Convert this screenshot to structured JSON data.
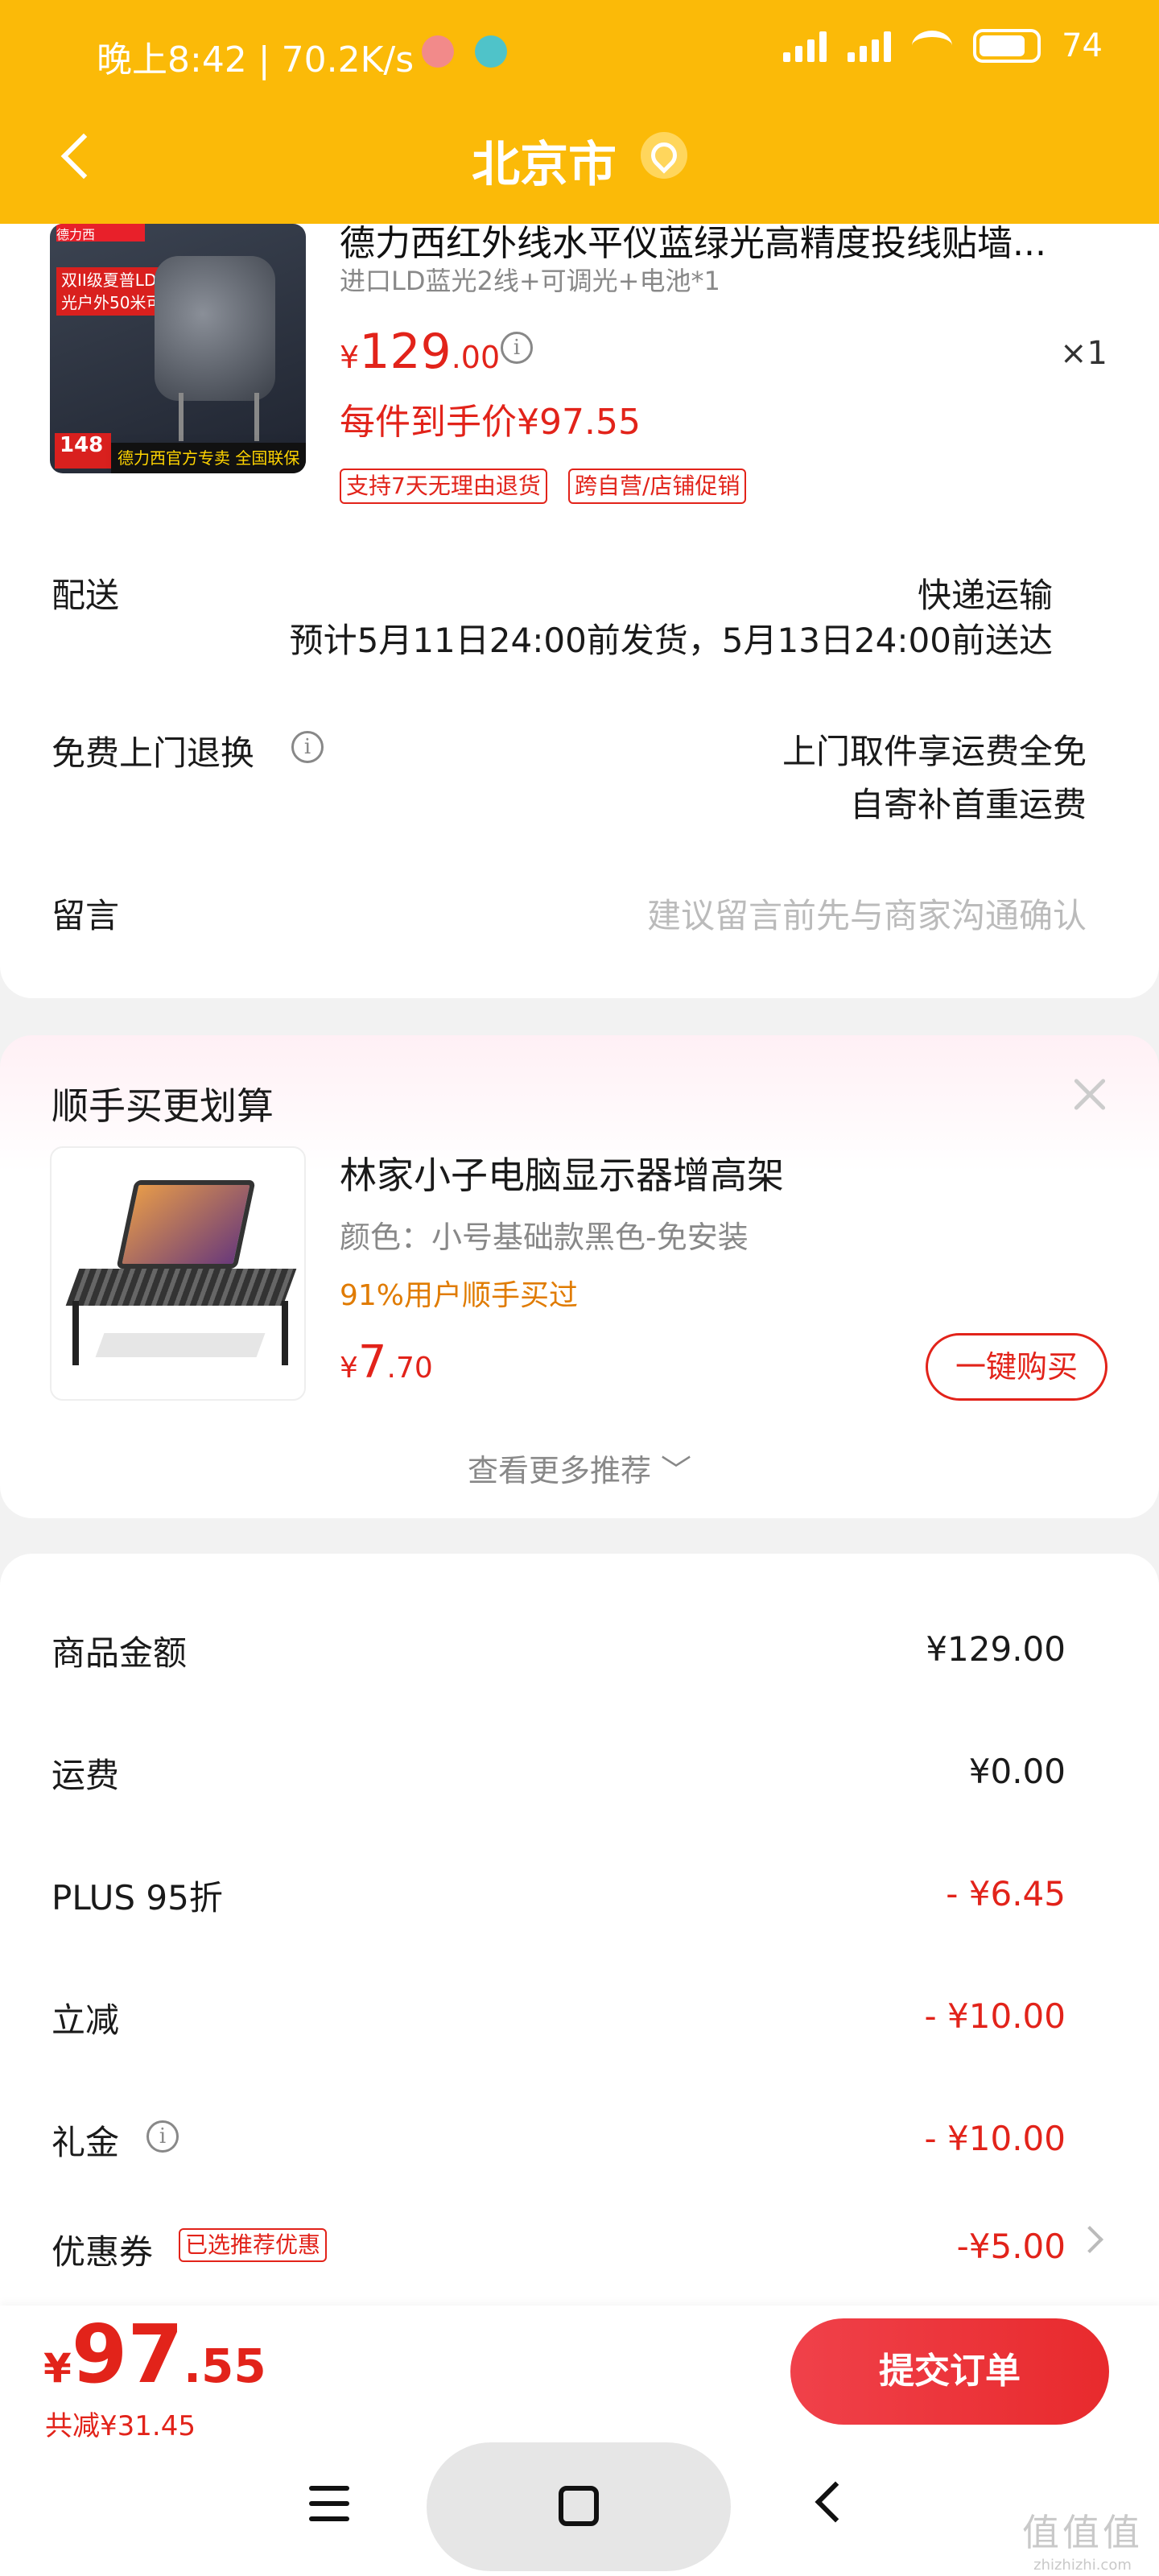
{
  "status_bar": {
    "time": "晚上8:42 | 70.2K/s",
    "battery": "74"
  },
  "header": {
    "city": "北京市"
  },
  "product": {
    "title": "德力西红外线水平仪蓝绿光高精度投线贴墙...",
    "spec": "进口LD蓝光2线+可调光+电池*1",
    "price_symbol": "¥",
    "price_int": "129",
    "price_dec": ".00",
    "quantity": "×1",
    "net_price": "每件到手价¥97.55",
    "tags": [
      "支持7天无理由退货",
      "跨自营/店铺促销"
    ],
    "image_text": {
      "brand": "德力西",
      "banner": "双II级夏普LD蓝光 阳光户外50米可视",
      "badge": "148",
      "footer": "德力西官方专卖 全国联保"
    }
  },
  "delivery": {
    "label": "配送",
    "method": "快递运输",
    "eta": "预计5月11日24:00前发货，5月13日24:00前送达"
  },
  "return_service": {
    "label": "免费上门退换",
    "line1": "上门取件享运费全免",
    "line2": "自寄补首重运费"
  },
  "message": {
    "label": "留言",
    "placeholder": "建议留言前先与商家沟通确认"
  },
  "recommend": {
    "section_title": "顺手买更划算",
    "title": "林家小子电脑显示器增高架",
    "spec": "颜色：小号基础款黑色-免安装",
    "bought": "91%用户顺手买过",
    "price_symbol": "¥",
    "price_int": "7",
    "price_dec": ".70",
    "buy_label": "一键购买",
    "more_label": "查看更多推荐 ﹀"
  },
  "summary": {
    "rows": [
      {
        "label": "商品金额",
        "value": "¥129.00"
      },
      {
        "label": "运费",
        "value": "¥0.00"
      },
      {
        "label": "PLUS 95折",
        "value": "- ¥6.45"
      },
      {
        "label": "立减",
        "value": "- ¥10.00"
      },
      {
        "label": "礼金",
        "value": "- ¥10.00"
      },
      {
        "label": "优惠券",
        "value": "-¥5.00"
      }
    ],
    "coupon_tag": "已选推荐优惠"
  },
  "bottom": {
    "price_symbol": "¥",
    "price_int": "97",
    "price_dec": ".55",
    "saved": "共减¥31.45",
    "submit_label": "提交订单"
  },
  "watermark": {
    "line1": "值值值",
    "line2": "zhizhizhi.com"
  },
  "colors": {
    "header_bg": "#fbba08",
    "accent_red": "#e2231a",
    "bought_orange": "#e07b00"
  }
}
